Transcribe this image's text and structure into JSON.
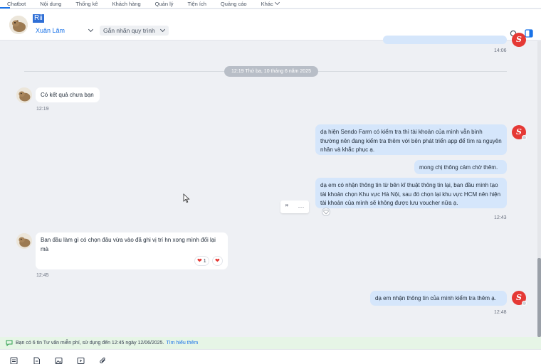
{
  "nav": {
    "items": [
      "Chatbot",
      "Nội dung",
      "Thống kê",
      "Khách hàng",
      "Quản lý",
      "Tiện ích",
      "Quảng cáo",
      "Khác"
    ]
  },
  "header": {
    "contact_name": "Rii",
    "assignee": "Xuân Lâm",
    "process_placeholder": "Gắn nhãn quy trình"
  },
  "messages": {
    "top_time": "14:06",
    "date_divider": "12:19 Thứ ba, 10 tháng 6 năm 2025",
    "m1": {
      "text": "Có kết quả chưa bạn",
      "time": "12:19"
    },
    "m2": {
      "text": "dạ hiện Sendo Farm có kiểm tra thì tài khoản của mình vẫn bình thường nên đang kiểm tra thêm với bên phát triển app để tìm ra nguyên nhân và khắc phục ạ."
    },
    "m3": {
      "text": "mong chị thông cảm chờ thêm."
    },
    "m4": {
      "text": "dạ em có nhận thông tin từ bên kĩ thuật thông tin lại, ban đầu mình tạo tài khoản chọn Khu vực Hà Nội, sau đó chọn lại khu vực HCM nên hiện tài khoản của mình sẽ không được lưu voucher nữa ạ.",
      "time": "12:43"
    },
    "m5": {
      "text": "Ban đầu làm gì có chọn đâu vừa vào đã ghi vị trí hn xong mình đổi lại mà",
      "time": "12:45",
      "reaction_count": "1"
    },
    "m6": {
      "text": "dạ em nhận thông tin của mình kiểm tra thêm ạ.",
      "time": "12:48"
    }
  },
  "toolbar": {
    "quote_glyph": "❞",
    "more_glyph": "···"
  },
  "info_bar": {
    "text": "Bạn có 6 tin Tư vấn miễn phí, sử dụng đến 12:45 ngày 12/06/2025.",
    "link": "Tìm hiểu thêm"
  },
  "colors": {
    "accent": "#1a73e8",
    "outgoing_bubble": "#d5e6fb",
    "brand_red": "#e53935"
  }
}
